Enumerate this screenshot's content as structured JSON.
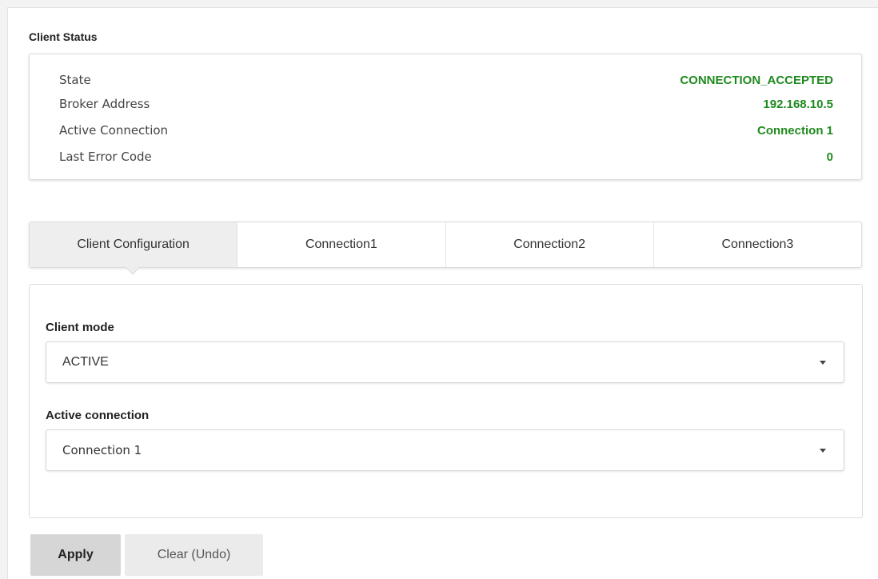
{
  "client_status": {
    "title": "Client Status",
    "rows": [
      {
        "label": "State",
        "value": "CONNECTION_ACCEPTED"
      },
      {
        "label": "Broker Address",
        "value": "192.168.10.5"
      },
      {
        "label": "Active Connection",
        "value": "Connection 1"
      },
      {
        "label": "Last Error Code",
        "value": "0"
      }
    ],
    "value_color": "#1e8a1e"
  },
  "tabs": [
    {
      "label": "Client Configuration",
      "active": true
    },
    {
      "label": "Connection1",
      "active": false
    },
    {
      "label": "Connection2",
      "active": false
    },
    {
      "label": "Connection3",
      "active": false
    }
  ],
  "config": {
    "client_mode": {
      "label": "Client mode",
      "value": "ACTIVE",
      "icon": "chevron-down-icon"
    },
    "active_connection": {
      "label": "Active connection",
      "value": "Connection 1",
      "icon": "chevron-down-icon"
    }
  },
  "actions": {
    "apply_label": "Apply",
    "clear_label": "Clear (Undo)"
  }
}
